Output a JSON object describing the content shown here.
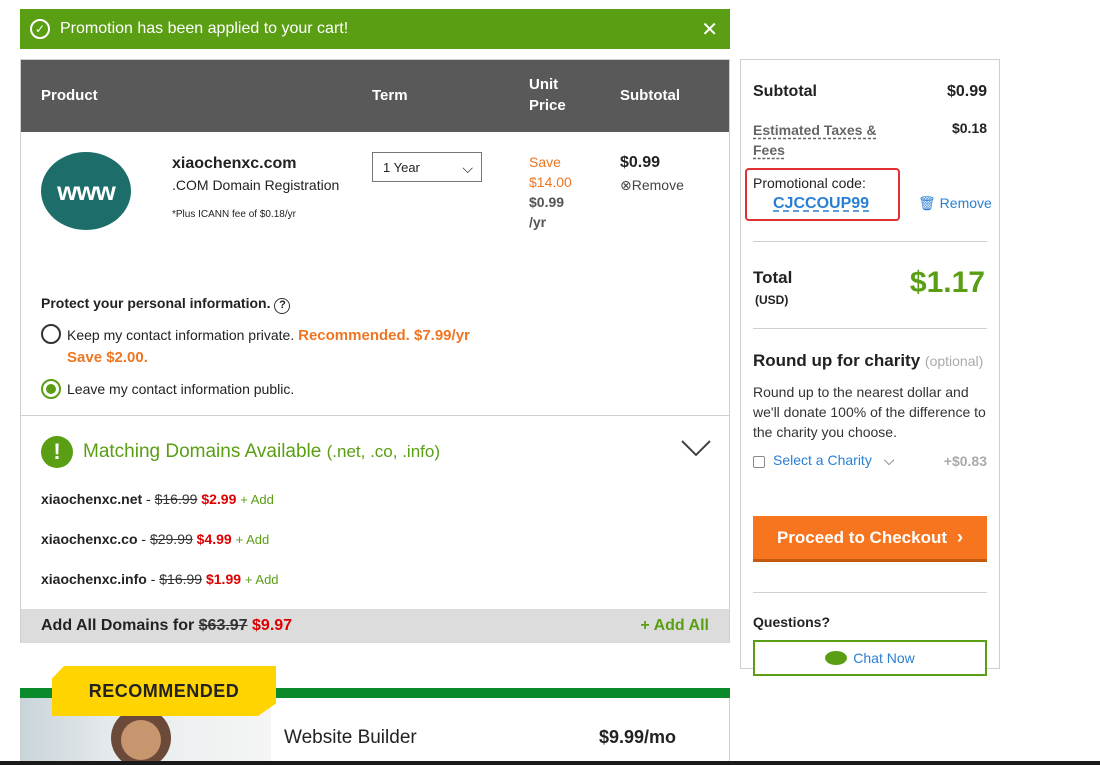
{
  "banner": {
    "message": "Promotion has been applied to your cart!",
    "check_icon": "check-circle-icon",
    "close_icon": "close-icon"
  },
  "cart": {
    "headers": {
      "product": "Product",
      "term": "Term",
      "unit_price_line1": "Unit",
      "unit_price_line2": "Price",
      "subtotal": "Subtotal"
    },
    "item": {
      "logo_text": "www",
      "name": "xiaochenxc.com",
      "type": ".COM Domain Registration",
      "fee_note": "*Plus ICANN fee of $0.18/yr",
      "term": "1 Year",
      "save_line1": "Save",
      "save_line2": "$14.00",
      "unit_line1": "$0.99",
      "unit_line2": "/yr",
      "subtotal": "$0.99",
      "remove": "Remove"
    },
    "privacy": {
      "title": "Protect your personal information.",
      "option_private": "Keep my contact information private.",
      "option_private_rec": "Recommended. $7.99/yr",
      "option_private_save": "Save $2.00.",
      "option_public": "Leave my contact information public.",
      "selected": "public"
    },
    "matching": {
      "title": "Matching Domains Available",
      "tlds": "(.net, .co, .info)",
      "items": [
        {
          "name": "xiaochenxc.net",
          "old": "$16.99",
          "new": "$2.99",
          "add": "+ Add"
        },
        {
          "name": "xiaochenxc.co",
          "old": "$29.99",
          "new": "$4.99",
          "add": "+ Add"
        },
        {
          "name": "xiaochenxc.info",
          "old": "$16.99",
          "new": "$1.99",
          "add": "+ Add"
        }
      ],
      "add_all_label": "Add All Domains for",
      "add_all_old": "$63.97",
      "add_all_new": "$9.97",
      "add_all_button": "+ Add All"
    }
  },
  "recommended": {
    "badge": "RECOMMENDED",
    "title": "Website Builder",
    "price": "$9.99/mo"
  },
  "summary": {
    "subtotal_label": "Subtotal",
    "subtotal_value": "$0.99",
    "tax_label": "Estimated Taxes & Fees",
    "tax_value": "$0.18",
    "promo_label": "Promotional code:",
    "promo_code": "CJCCOUP99",
    "promo_remove": "Remove",
    "total_label": "Total",
    "total_currency": "(USD)",
    "total_value": "$1.17",
    "charity_title": "Round up for charity",
    "charity_optional": "(optional)",
    "charity_desc": "Round up to the nearest dollar and we'll donate 100% of the difference to the charity you choose.",
    "charity_select": "Select a Charity",
    "charity_amount": "+$0.83",
    "checkout": "Proceed to Checkout",
    "questions": "Questions?",
    "chat": "Chat Now"
  },
  "colors": {
    "green": "#5a9e14",
    "orange": "#f7751e",
    "red": "#dd0000",
    "link": "#2a7fd4",
    "header": "#595959"
  }
}
